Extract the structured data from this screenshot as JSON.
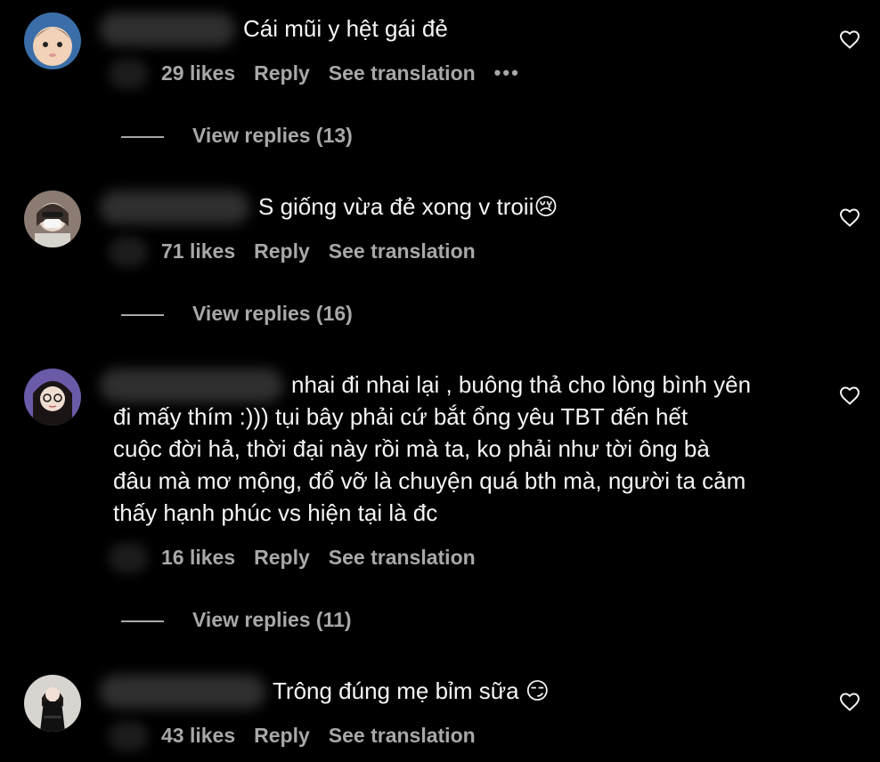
{
  "comments": [
    {
      "text": "Cái mũi y hệt gái đẻ",
      "likes": "29 likes",
      "reply": "Reply",
      "translation": "See translation",
      "more": "•••",
      "view_replies": "View replies (13)",
      "avatar_icon": "avatar-baby-icon"
    },
    {
      "text": "S giống vừa đẻ xong v troii😢",
      "likes": "71 likes",
      "reply": "Reply",
      "translation": "See translation",
      "view_replies": "View replies (16)",
      "avatar_icon": "avatar-mask-icon"
    },
    {
      "text": "nhai đi nhai lại , buông thả cho lòng bình yên\nđi mấy thím :))) tụi bây phải cứ bắt ổng yêu TBT đến hết\ncuộc đời hả, thời đại này rồi mà ta, ko phải như tời ông bà\nđâu mà mơ mộng, đổ vỡ là chuyện quá bth mà, người ta cảm\nthấy hạnh phúc vs hiện tại là đc",
      "likes": "16 likes",
      "reply": "Reply",
      "translation": "See translation",
      "view_replies": "View replies (11)",
      "avatar_icon": "avatar-glasses-icon"
    },
    {
      "text": "Trông đúng mẹ bỉm sữa 😏",
      "likes": "43 likes",
      "reply": "Reply",
      "translation": "See translation",
      "avatar_icon": "avatar-dress-icon"
    }
  ],
  "colors": {
    "background": "#000000",
    "text": "#f5f5f5",
    "secondary": "#a8a8a8"
  }
}
